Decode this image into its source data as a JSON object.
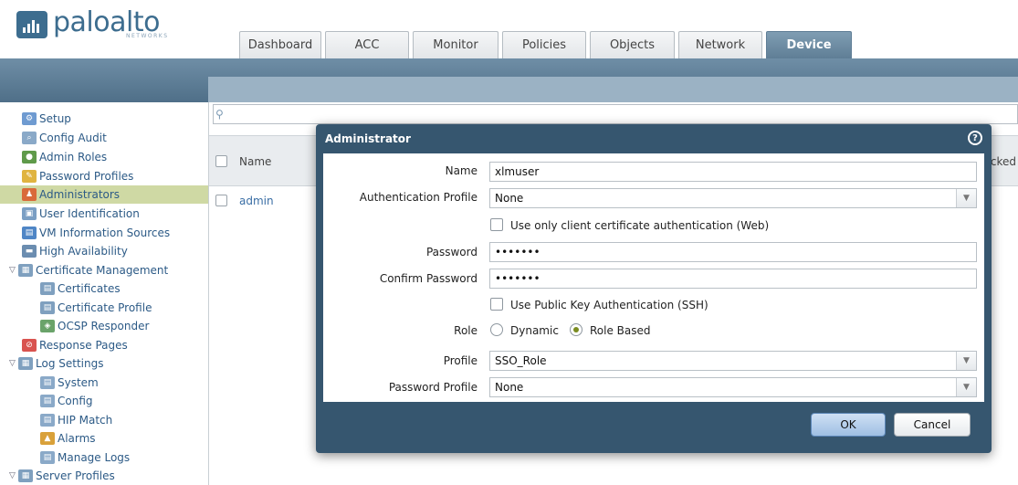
{
  "brand": {
    "name": "paloalto",
    "sub": "NETWORKS"
  },
  "tabs": [
    {
      "label": "Dashboard"
    },
    {
      "label": "ACC"
    },
    {
      "label": "Monitor"
    },
    {
      "label": "Policies"
    },
    {
      "label": "Objects"
    },
    {
      "label": "Network"
    },
    {
      "label": "Device"
    }
  ],
  "active_tab": "Device",
  "sidebar": {
    "items": [
      {
        "label": "Setup",
        "icon": "setup-icon"
      },
      {
        "label": "Config Audit",
        "icon": "config-audit-icon"
      },
      {
        "label": "Admin Roles",
        "icon": "admin-roles-icon"
      },
      {
        "label": "Password Profiles",
        "icon": "password-profiles-icon"
      },
      {
        "label": "Administrators",
        "icon": "administrators-icon",
        "selected": true
      },
      {
        "label": "User Identification",
        "icon": "user-identification-icon"
      },
      {
        "label": "VM Information Sources",
        "icon": "vm-info-icon"
      },
      {
        "label": "High Availability",
        "icon": "high-availability-icon"
      },
      {
        "label": "Certificate Management",
        "icon": "certificate-management-icon",
        "expanded": true
      },
      {
        "label": "Certificates",
        "icon": "certificates-icon"
      },
      {
        "label": "Certificate Profile",
        "icon": "certificate-profile-icon"
      },
      {
        "label": "OCSP Responder",
        "icon": "ocsp-icon"
      },
      {
        "label": "Response Pages",
        "icon": "response-pages-icon"
      },
      {
        "label": "Log Settings",
        "icon": "log-settings-icon",
        "expanded": true
      },
      {
        "label": "System",
        "icon": "system-log-icon"
      },
      {
        "label": "Config",
        "icon": "config-log-icon"
      },
      {
        "label": "HIP Match",
        "icon": "hip-match-icon"
      },
      {
        "label": "Alarms",
        "icon": "alarms-icon"
      },
      {
        "label": "Manage Logs",
        "icon": "manage-logs-icon"
      },
      {
        "label": "Server Profiles",
        "icon": "server-profiles-icon",
        "expanded": true
      }
    ]
  },
  "table": {
    "headers": {
      "name": "Name",
      "locked": "ocked"
    },
    "rows": [
      {
        "name": "admin"
      }
    ]
  },
  "dialog": {
    "title": "Administrator",
    "name_label": "Name",
    "name_value": "xlmuser",
    "auth_profile_label": "Authentication Profile",
    "auth_profile_value": "None",
    "client_cert_label": "Use only client certificate authentication (Web)",
    "password_label": "Password",
    "password_value": "•••••••",
    "confirm_label": "Confirm Password",
    "confirm_value": "•••••••",
    "pubkey_label": "Use Public Key Authentication (SSH)",
    "role_label": "Role",
    "role_dynamic": "Dynamic",
    "role_based": "Role Based",
    "role_selected": "Role Based",
    "profile_label": "Profile",
    "profile_value": "SSO_Role",
    "password_profile_label": "Password Profile",
    "password_profile_value": "None",
    "ok_label": "OK",
    "cancel_label": "Cancel"
  },
  "colors": {
    "brand": "#3d6d8f",
    "header_bar": "#5f7e96",
    "dialog_frame": "#36566f",
    "selected_row": "#cfd9a4",
    "link": "#2c5a86",
    "radio_on": "#7a8c20"
  }
}
